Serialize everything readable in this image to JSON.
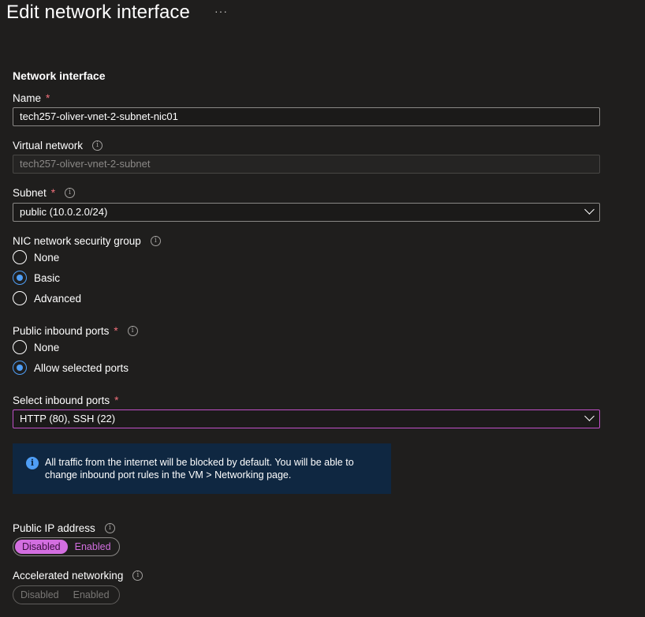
{
  "page": {
    "title": "Edit network interface",
    "more_label": "···"
  },
  "form": {
    "section_title": "Network interface",
    "name": {
      "label": "Name",
      "required": "*",
      "value": "tech257-oliver-vnet-2-subnet-nic01"
    },
    "virtual_network": {
      "label": "Virtual network",
      "value": "tech257-oliver-vnet-2-subnet"
    },
    "subnet": {
      "label": "Subnet",
      "required": "*",
      "value": "public (10.0.2.0/24)"
    },
    "nsg": {
      "label": "NIC network security group",
      "options": [
        "None",
        "Basic",
        "Advanced"
      ],
      "selected": "Basic"
    },
    "public_ports": {
      "label": "Public inbound ports",
      "required": "*",
      "options": [
        "None",
        "Allow selected ports"
      ],
      "selected": "Allow selected ports"
    },
    "inbound_ports": {
      "label": "Select inbound ports",
      "required": "*",
      "value": "HTTP (80), SSH (22)"
    },
    "info_message": "All traffic from the internet will be blocked by default. You will be able to change inbound port rules in the VM > Networking page.",
    "public_ip": {
      "label": "Public IP address",
      "options": [
        "Disabled",
        "Enabled"
      ],
      "selected": "Disabled"
    },
    "accelerated": {
      "label": "Accelerated networking",
      "options": [
        "Disabled",
        "Enabled"
      ],
      "selected": "Disabled"
    }
  },
  "icons": {
    "info": "info-icon",
    "chevron": "chevron-down-icon",
    "more": "more-icon"
  },
  "colors": {
    "background": "#1f1e1d",
    "accent": "#4f9ef5",
    "required": "#f1707b",
    "toggle": "#d36ee0",
    "info_bg": "#0f2741"
  }
}
